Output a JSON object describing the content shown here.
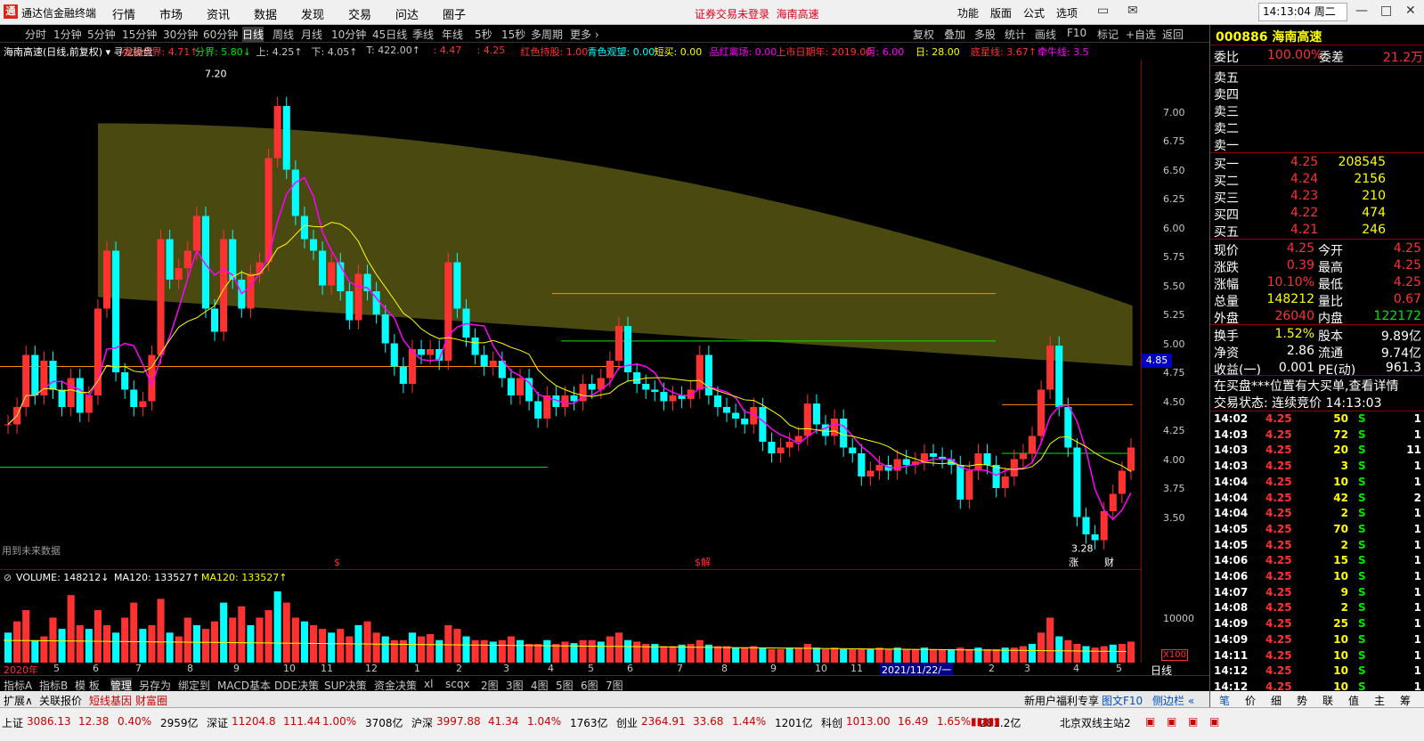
{
  "app": {
    "name": "通达信金融终端",
    "logo": "通",
    "notice": "证券交易未登录",
    "stock_name": "海南高速",
    "clock": "14:13:04 周二"
  },
  "menus": [
    "行情",
    "市场",
    "资讯",
    "数据",
    "发现",
    "交易",
    "问达",
    "圈子"
  ],
  "right_menus": [
    "功能",
    "版面",
    "公式",
    "选项"
  ],
  "periods": [
    "分时",
    "1分钟",
    "5分钟",
    "15分钟",
    "30分钟",
    "60分钟",
    "日线",
    "周线",
    "月线",
    "10分钟",
    "45日线",
    "季线",
    "年线",
    "5秒",
    "15秒",
    "多周期",
    "更多 ›"
  ],
  "active_period": "日线",
  "tools": [
    "复权",
    "叠加",
    "多股",
    "统计",
    "画线",
    "F10",
    "标记",
    "+自选",
    "返回"
  ],
  "indicator_bar": [
    {
      "t": "海南高速(日线,前复权) ▾ 寻龙操盘",
      "c": "#ffffff"
    },
    {
      "t": "强弱分界: 4.71↑",
      "c": "#ff3232"
    },
    {
      "t": "分界: 5.80↓",
      "c": "#00e600"
    },
    {
      "t": "上: 4.25↑",
      "c": "#c8c8c8"
    },
    {
      "t": "下: 4.05↑",
      "c": "#c8c8c8"
    },
    {
      "t": "T: 422.00↑",
      "c": "#c8c8c8"
    },
    {
      "t": ": 4.47",
      "c": "#ff3232"
    },
    {
      "t": ": 4.25",
      "c": "#ff3232"
    },
    {
      "t": "红色持股: 1.00",
      "c": "#ff3232"
    },
    {
      "t": "青色观望: 0.00",
      "c": "#00ffff"
    },
    {
      "t": "短买: 0.00",
      "c": "#ffff00"
    },
    {
      "t": "品红离场: 0.00",
      "c": "#ff00ff"
    },
    {
      "t": "上市日期年: 2019.00",
      "c": "#ff3232"
    },
    {
      "t": "月: 6.00",
      "c": "#ff00ff"
    },
    {
      "t": "日: 28.00",
      "c": "#ffff00"
    },
    {
      "t": "底星线: 3.67↑",
      "c": "#ff3232"
    },
    {
      "t": "牵牛线: 3.5",
      "c": "#ff00ff"
    }
  ],
  "chart_data": {
    "type": "candlestick",
    "price_axis": [
      "7.00",
      "6.75",
      "6.50",
      "6.25",
      "6.00",
      "5.75",
      "5.50",
      "5.25",
      "5.00",
      "4.75",
      "4.50",
      "4.25",
      "4.00",
      "3.75",
      "3.50"
    ],
    "current_price_label": "4.85",
    "high_label": "7.20",
    "low_label": "3.28",
    "ylim": [
      3.05,
      7.45
    ],
    "annotation": "用到未来数据",
    "event_markers": [
      "$",
      "$解",
      "涨",
      "财"
    ],
    "closes": [
      4.3,
      4.45,
      4.9,
      4.55,
      4.85,
      4.6,
      4.45,
      4.7,
      4.4,
      4.55,
      5.3,
      5.8,
      4.75,
      4.6,
      4.45,
      4.5,
      4.9,
      5.9,
      5.55,
      5.65,
      5.8,
      6.1,
      5.3,
      5.1,
      5.9,
      5.55,
      5.3,
      5.6,
      5.7,
      6.6,
      7.05,
      6.5,
      6.1,
      5.9,
      5.8,
      5.5,
      5.7,
      5.45,
      5.2,
      5.6,
      5.45,
      5.25,
      5.0,
      4.8,
      4.65,
      4.95,
      4.9,
      4.95,
      4.85,
      5.7,
      5.3,
      5.05,
      4.9,
      4.8,
      4.85,
      4.7,
      4.55,
      4.7,
      4.5,
      4.35,
      4.55,
      4.45,
      4.55,
      4.5,
      4.65,
      4.6,
      4.7,
      4.85,
      5.15,
      4.75,
      4.65,
      4.6,
      4.58,
      4.5,
      4.55,
      4.52,
      4.6,
      4.9,
      4.55,
      4.45,
      4.4,
      4.35,
      4.3,
      4.45,
      4.15,
      4.05,
      4.1,
      4.15,
      4.2,
      4.48,
      4.3,
      4.2,
      4.35,
      4.1,
      4.05,
      3.85,
      3.9,
      3.95,
      3.9,
      4.0,
      3.95,
      3.98,
      4.05,
      4.02,
      4.0,
      3.95,
      3.65,
      3.9,
      4.05,
      3.95,
      3.75,
      3.85,
      4.0,
      4.05,
      4.2,
      4.6,
      4.98,
      4.45,
      4.1,
      3.5,
      3.35,
      3.3,
      3.55,
      3.7,
      3.9,
      4.1
    ],
    "upper_line": 4.3,
    "lower_line": 4.05,
    "volume": {
      "label": "VOLUME: 148212↓",
      "ma1": "MA120: 133527↑",
      "ma2": "MA120: 133527↑",
      "axis": [
        "10000",
        "X100"
      ],
      "values": [
        40,
        55,
        70,
        30,
        35,
        60,
        45,
        90,
        50,
        45,
        70,
        50,
        40,
        60,
        80,
        45,
        50,
        85,
        40,
        35,
        60,
        50,
        45,
        55,
        80,
        60,
        75,
        50,
        60,
        70,
        95,
        80,
        60,
        55,
        50,
        45,
        40,
        45,
        35,
        50,
        55,
        40,
        35,
        30,
        30,
        40,
        35,
        38,
        30,
        50,
        45,
        35,
        30,
        30,
        28,
        30,
        35,
        30,
        25,
        25,
        30,
        25,
        28,
        26,
        30,
        30,
        28,
        35,
        40,
        30,
        28,
        25,
        25,
        22,
        22,
        24,
        25,
        30,
        24,
        22,
        22,
        20,
        20,
        22,
        20,
        18,
        18,
        20,
        20,
        25,
        20,
        18,
        20,
        18,
        18,
        18,
        18,
        20,
        18,
        20,
        18,
        18,
        20,
        18,
        18,
        18,
        20,
        18,
        20,
        18,
        18,
        20,
        20,
        22,
        25,
        40,
        60,
        35,
        30,
        25,
        22,
        20,
        22,
        24,
        25,
        28
      ]
    }
  },
  "time_axis": [
    "2020年",
    "5",
    "6",
    "7",
    "8",
    "9",
    "10",
    "11",
    "12",
    "1",
    "2",
    "3",
    "4",
    "5",
    "6",
    "7",
    "8",
    "9",
    "10",
    "11",
    "2021/11/22/一",
    "2",
    "3",
    "4",
    "5"
  ],
  "right_axis_label": "日线",
  "tabs": [
    "指标A",
    "指标B",
    "模 板",
    "管理",
    "另存为",
    "绑定到",
    "MACD基本",
    "DDE决策",
    "SUP决策",
    "资金决策",
    "xl",
    "scqx",
    "2图",
    "3图",
    "4图",
    "5图",
    "6图",
    "7图"
  ],
  "active_tab": "管理",
  "expand_bar": [
    "扩展∧",
    "关联报价",
    "短线基因",
    "财富圈"
  ],
  "expand_right": [
    "新用户福利专享",
    "图文F10",
    "侧边栏 «"
  ],
  "status": [
    {
      "name": "上证",
      "val": "3086.13",
      "chg": "12.38",
      "pct": "0.40%",
      "amt": "2959亿"
    },
    {
      "name": "深证",
      "val": "11204.8",
      "chg": "111.44",
      "pct": "1.00%",
      "amt": "3708亿"
    },
    {
      "name": "沪深",
      "val": "3997.88",
      "chg": "41.34",
      "pct": "1.04%",
      "amt": "1763亿"
    },
    {
      "name": "创业",
      "val": "2364.91",
      "chg": "33.68",
      "pct": "1.44%",
      "amt": "1201亿"
    },
    {
      "name": "科创",
      "val": "1013.00",
      "chg": "16.49",
      "pct": "1.65%",
      "amt": "281.2亿"
    }
  ],
  "server": "北京双线主站2",
  "panel": {
    "code": "000886",
    "name": "海南高速",
    "weibi_label": "委比",
    "weibi": "100.00%",
    "weicha_label": "委差",
    "weicha": "21.2万",
    "sells": [
      "卖五",
      "卖四",
      "卖三",
      "卖二",
      "卖一"
    ],
    "buys": [
      {
        "l": "买一",
        "p": "4.25",
        "v": "208545"
      },
      {
        "l": "买二",
        "p": "4.24",
        "v": "2156"
      },
      {
        "l": "买三",
        "p": "4.23",
        "v": "210"
      },
      {
        "l": "买四",
        "p": "4.22",
        "v": "474"
      },
      {
        "l": "买五",
        "p": "4.21",
        "v": "246"
      }
    ],
    "stats": [
      {
        "l1": "现价",
        "v1": "4.25",
        "l2": "今开",
        "v2": "4.25"
      },
      {
        "l1": "涨跌",
        "v1": "0.39",
        "l2": "最高",
        "v2": "4.25"
      },
      {
        "l1": "涨幅",
        "v1": "10.10%",
        "l2": "最低",
        "v2": "4.25"
      },
      {
        "l1": "总量",
        "v1": "148212",
        "l2": "量比",
        "v2": "0.67"
      },
      {
        "l1": "外盘",
        "v1": "26040",
        "l2": "内盘",
        "v2": "122172"
      }
    ],
    "stats2": [
      {
        "l1": "换手",
        "v1": "1.52%",
        "l2": "股本",
        "v2": "9.89亿"
      },
      {
        "l1": "净资",
        "v1": "2.86",
        "l2": "流通",
        "v2": "9.74亿"
      },
      {
        "l1": "收益(一)",
        "v1": "0.001",
        "l2": "PE(动)",
        "v2": "961.3"
      }
    ],
    "notice": "在买盘***位置有大买单,查看详情",
    "trade_status": "交易状态: 连续竞价 14:13:03",
    "ticks": [
      {
        "t": "14:02",
        "p": "4.25",
        "v": "50",
        "s": "S",
        "n": "1"
      },
      {
        "t": "14:03",
        "p": "4.25",
        "v": "72",
        "s": "S",
        "n": "1"
      },
      {
        "t": "14:03",
        "p": "4.25",
        "v": "20",
        "s": "S",
        "n": "11"
      },
      {
        "t": "14:03",
        "p": "4.25",
        "v": "3",
        "s": "S",
        "n": "1"
      },
      {
        "t": "14:04",
        "p": "4.25",
        "v": "10",
        "s": "S",
        "n": "1"
      },
      {
        "t": "14:04",
        "p": "4.25",
        "v": "42",
        "s": "S",
        "n": "2"
      },
      {
        "t": "14:04",
        "p": "4.25",
        "v": "2",
        "s": "S",
        "n": "1"
      },
      {
        "t": "14:05",
        "p": "4.25",
        "v": "70",
        "s": "S",
        "n": "1"
      },
      {
        "t": "14:05",
        "p": "4.25",
        "v": "2",
        "s": "S",
        "n": "1"
      },
      {
        "t": "14:06",
        "p": "4.25",
        "v": "15",
        "s": "S",
        "n": "1"
      },
      {
        "t": "14:06",
        "p": "4.25",
        "v": "10",
        "s": "S",
        "n": "1"
      },
      {
        "t": "14:07",
        "p": "4.25",
        "v": "9",
        "s": "S",
        "n": "1"
      },
      {
        "t": "14:08",
        "p": "4.25",
        "v": "2",
        "s": "S",
        "n": "1"
      },
      {
        "t": "14:09",
        "p": "4.25",
        "v": "25",
        "s": "S",
        "n": "1"
      },
      {
        "t": "14:09",
        "p": "4.25",
        "v": "10",
        "s": "S",
        "n": "1"
      },
      {
        "t": "14:11",
        "p": "4.25",
        "v": "10",
        "s": "S",
        "n": "1"
      },
      {
        "t": "14:12",
        "p": "4.25",
        "v": "10",
        "s": "S",
        "n": "1"
      },
      {
        "t": "14:12",
        "p": "4.25",
        "v": "10",
        "s": "S",
        "n": "1"
      }
    ],
    "bottom_tabs": [
      "笔",
      "价",
      "细",
      "势",
      "联",
      "值",
      "主",
      "筹"
    ]
  }
}
